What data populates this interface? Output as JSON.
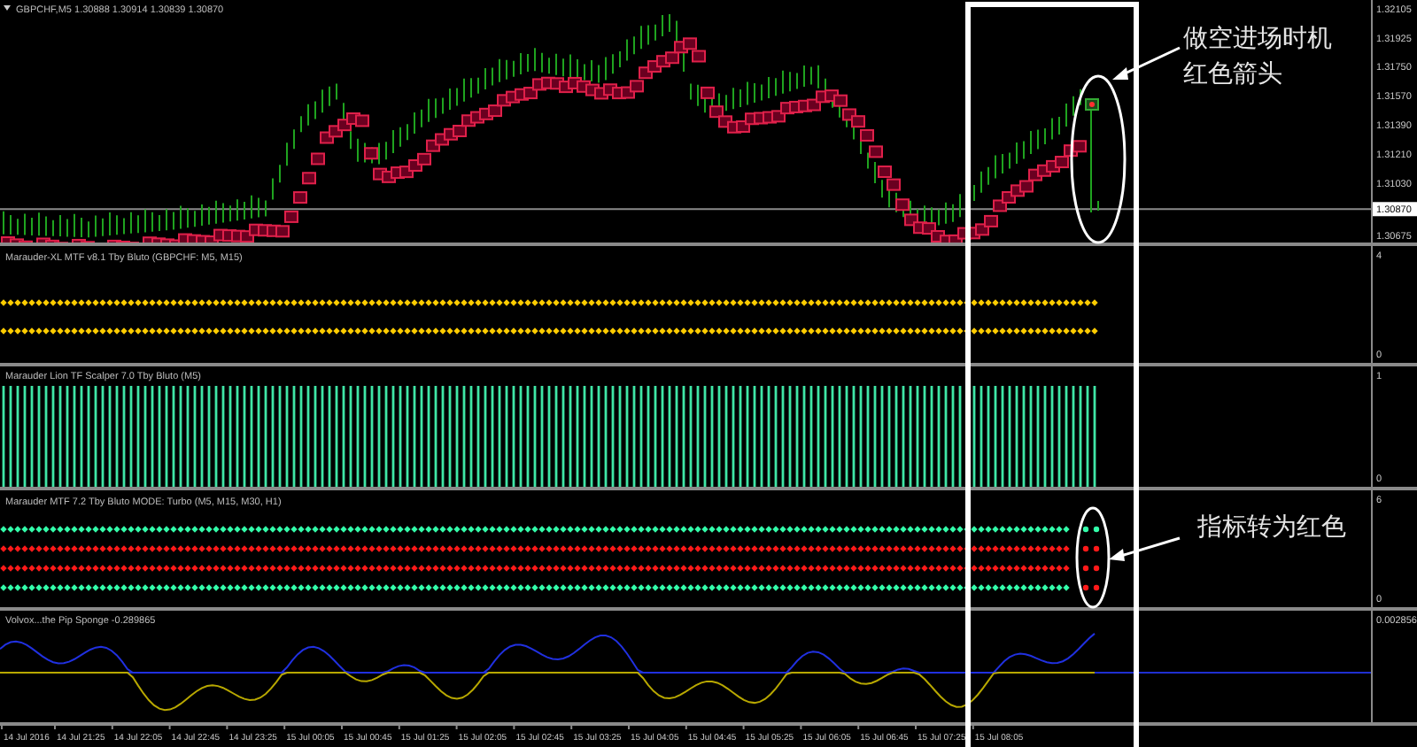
{
  "main_chart": {
    "header": "GBPCHF,M5  1.30888 1.30914 1.30839 1.30870",
    "price_scale": [
      "1.32105",
      "1.31925",
      "1.31750",
      "1.31570",
      "1.31390",
      "1.31210",
      "1.31030",
      "1.30675"
    ],
    "current_price": "1.30870"
  },
  "indicators": [
    {
      "kind": "dots",
      "title": "Marauder-XL MTF v8.1  Tby Bluto (GBPCHF: M5, M15)",
      "scale": [
        "4",
        "0"
      ],
      "rows": [
        {
          "color": "#ffcc00"
        },
        {
          "color": "#ffcc00"
        }
      ]
    },
    {
      "kind": "histogram",
      "title": "Marauder Lion TF Scalper 7.0  Tby Bluto (M5)",
      "scale": [
        "1",
        "0"
      ]
    },
    {
      "kind": "dots",
      "title": "Marauder MTF 7.2  Tby Bluto  MODE: Turbo  (M5, M15, M30, H1)",
      "scale": [
        "6",
        "0"
      ],
      "rows": [
        {
          "color": "#33ffaa"
        },
        {
          "color": "#ff1a1a"
        },
        {
          "color": "#ff1a1a"
        },
        {
          "color": "#33ffaa"
        }
      ],
      "signal_dots": [
        {
          "color": "#33ffaa"
        },
        {
          "color": "#ff1a1a"
        },
        {
          "color": "#ff1a1a"
        },
        {
          "color": "#ff1a1a"
        }
      ]
    },
    {
      "kind": "oscillator",
      "title": "Volvox...the Pip Sponge -0.289865",
      "scale": [
        "0.002856"
      ]
    }
  ],
  "time_axis": [
    "14 Jul 2016",
    "14 Jul 21:25",
    "14 Jul 22:05",
    "14 Jul 22:45",
    "14 Jul 23:25",
    "15 Jul 00:05",
    "15 Jul 00:45",
    "15 Jul 01:25",
    "15 Jul 02:05",
    "15 Jul 02:45",
    "15 Jul 03:25",
    "15 Jul 04:05",
    "15 Jul 04:45",
    "15 Jul 05:25",
    "15 Jul 06:05",
    "15 Jul 06:45",
    "15 Jul 07:25",
    "15 Jul 08:05"
  ],
  "annotations": [
    {
      "lines": [
        "做空进场时机",
        "红色箭头"
      ]
    },
    {
      "lines": [
        "指标转为红色"
      ]
    }
  ]
}
